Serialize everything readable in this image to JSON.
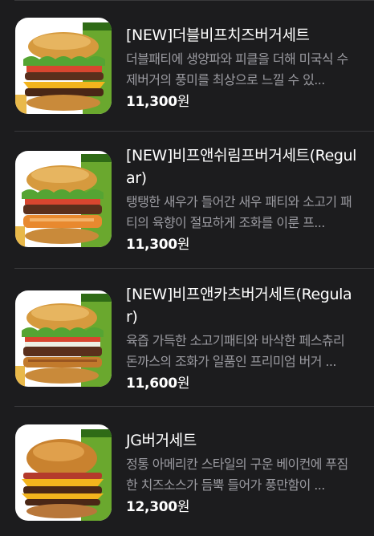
{
  "menu": {
    "items": [
      {
        "name": "[NEW]더블비프치즈버거세트",
        "description": "더블패티에 생양파와 피클을 더해 미국식 수제버거의 풍미를 최상으로 느낄 수 있...",
        "price": "11,300",
        "currency": "원",
        "image": "double-beef-cheese-burger-set-image"
      },
      {
        "name": "[NEW]비프앤쉬림프버거세트(Regular)",
        "description": "탱탱한 새우가 들어간 새우 패티와 소고기 패티의 육향이 절묘하게 조화를 이룬 프...",
        "price": "11,300",
        "currency": "원",
        "image": "beef-shrimp-burger-set-image"
      },
      {
        "name": "[NEW]비프앤카츠버거세트(Regular)",
        "description": "육즙 가득한 소고기패티와 바삭한 페스츄리 돈까스의 조화가 일품인 프리미엄 버거 ...",
        "price": "11,600",
        "currency": "원",
        "image": "beef-katsu-burger-set-image"
      },
      {
        "name": "JG버거세트",
        "description": "정통 아메리칸 스타일의 구운 베이컨에 푸짐한 치즈소스가 듬뿍 들어가 풍만함이 ...",
        "price": "12,300",
        "currency": "원",
        "image": "jg-burger-set-image"
      }
    ]
  },
  "colors": {
    "background": "#1c1c1e",
    "text_primary": "#ffffff",
    "text_secondary": "#9a9aa0",
    "divider": "#38383b"
  }
}
